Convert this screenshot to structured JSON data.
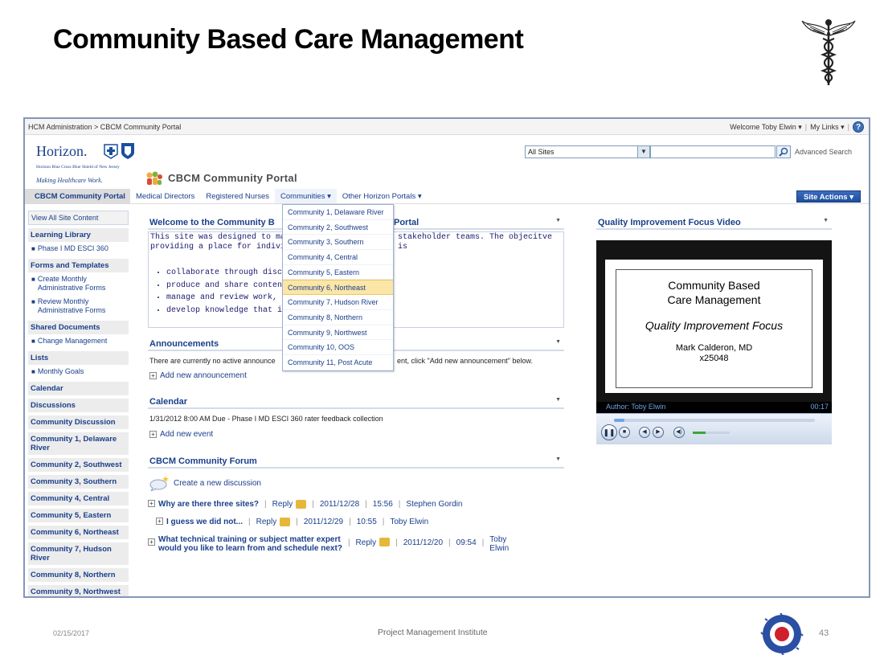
{
  "slide": {
    "title": "Community Based Care Management",
    "footer_date": "02/15/2017",
    "footer_center": "Project Management Institute",
    "page_number": "43"
  },
  "portal": {
    "breadcrumb": "HCM Administration > CBCM Community Portal",
    "welcome_user": "Welcome Toby Elwin ▾",
    "my_links": "My Links ▾",
    "help_label": "?",
    "logo_text": "Horizon.",
    "logo_subtext": "Horizon Blue Cross Blue Shield of New Jersey",
    "logo_tagline": "Making Healthcare Work.",
    "site_title": "CBCM Community Portal",
    "search_scope": "All Sites",
    "search_value": "",
    "advanced_search": "Advanced Search",
    "nav": {
      "items": [
        "CBCM Community Portal",
        "Medical Directors",
        "Registered Nurses",
        "Communities ▾",
        "Other Horizon Portals ▾"
      ],
      "site_actions": "Site Actions ▾"
    },
    "communities_menu": [
      "Community 1, Delaware River",
      "Community 2, Southwest",
      "Community 3, Southern",
      "Community 4, Central",
      "Community 5, Eastern",
      "Community 6, Northeast",
      "Community 7, Hudson River",
      "Community 8, Northern",
      "Community 9, Northwest",
      "Community 10, OOS",
      "Community 11, Post Acute"
    ],
    "quick_launch": {
      "view_all": "View All Site Content",
      "learning_library": "Learning Library",
      "learning_items": [
        "Phase I MD ESCI 360"
      ],
      "forms_templates": "Forms and Templates",
      "forms_items": [
        "Create Monthly Administrative Forms",
        "Review Monthly Administrative Forms"
      ],
      "shared_documents": "Shared Documents",
      "shared_items": [
        "Change Management"
      ],
      "lists": "Lists",
      "lists_items": [
        "Monthly Goals"
      ],
      "headings": [
        "Calendar",
        "Discussions",
        "Community Discussion",
        "Community 1, Delaware River",
        "Community 2, Southwest",
        "Community 3, Southern",
        "Community 4, Central",
        "Community 5, Eastern",
        "Community 6, Northeast",
        "Community 7, Hudson River",
        "Community 8, Northern",
        "Community 9, Northwest"
      ]
    },
    "welcome": {
      "title_left": "Welcome to the Community B",
      "title_right": "Portal",
      "line1_left": "This site was designed to manage",
      "line1_right": "stakeholder teams.  The objecitve is",
      "line2_left": "providing a place for individuals t",
      "bullets": [
        "collaborate through discus",
        "produce and share conten",
        "manage and review work,",
        "develop knowledge that in"
      ]
    },
    "announcements": {
      "title": "Announcements",
      "message_left": "There are currently no active announce",
      "message_right": "ent, click \"Add new announcement\" below.",
      "add_link": "Add new announcement"
    },
    "calendar": {
      "title": "Calendar",
      "event": "1/31/2012 8:00 AM  Due - Phase I MD ESCI 360 rater feedback collection",
      "add_link": "Add new event"
    },
    "forum": {
      "title": "CBCM Community Forum",
      "create_link": "Create a new discussion",
      "posts": [
        {
          "topic": "Why are there three sites?",
          "reply": "Reply",
          "date": "2011/12/28",
          "time": "15:56",
          "author": "Stephen Gordin"
        },
        {
          "topic": "I guess we did not...",
          "reply": "Reply",
          "date": "2011/12/29",
          "time": "10:55",
          "author": "Toby Elwin"
        },
        {
          "topic_line1": "What technical training or subject matter expert",
          "topic_line2": "would you like to learn from and schedule next?",
          "reply": "Reply",
          "date": "2011/12/20",
          "time": "09:54",
          "author_line1": "Toby",
          "author_line2": "Elwin"
        }
      ]
    },
    "video": {
      "title": "Quality Improvement Focus Video",
      "slide_title_line1": "Community Based",
      "slide_title_line2": "Care Management",
      "slide_subtitle": "Quality Improvement Focus",
      "presenter": "Mark Calderon, MD",
      "extension": "x25048",
      "author": "Author: Toby Elwin",
      "timestamp": "00:17",
      "progress_fraction": 0.05,
      "volume_fraction": 0.35
    }
  }
}
